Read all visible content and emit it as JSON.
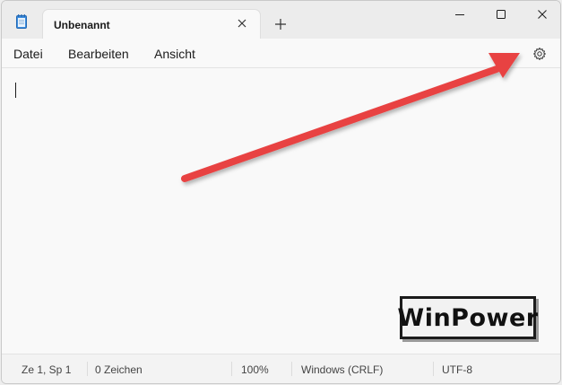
{
  "tab": {
    "title": "Unbenannt"
  },
  "menu": {
    "items": [
      "Datei",
      "Bearbeiten",
      "Ansicht"
    ]
  },
  "editor": {
    "content": ""
  },
  "watermark": {
    "text": "WinPower"
  },
  "status": {
    "position": "Ze 1, Sp 1",
    "chars": "0 Zeichen",
    "zoom": "100%",
    "line_ending": "Windows (CRLF)",
    "encoding": "UTF-8"
  },
  "icons": {
    "app": "notepad-icon",
    "tab_close": "close-icon",
    "new_tab": "plus-icon",
    "minimize": "minimize-icon",
    "maximize": "maximize-icon",
    "close": "close-icon",
    "settings": "gear-icon"
  },
  "colors": {
    "arrow": "#e84343",
    "accent": "#2d7fd4"
  }
}
